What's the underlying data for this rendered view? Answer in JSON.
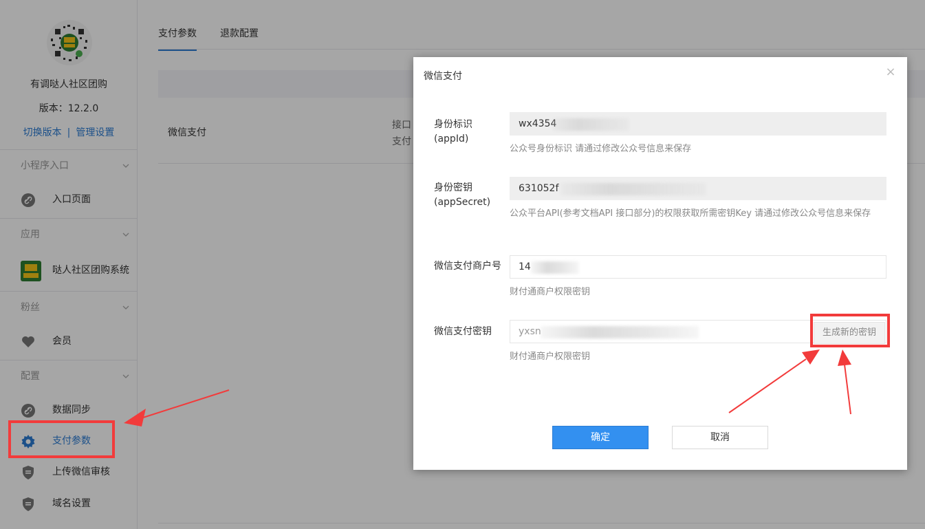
{
  "sidebar": {
    "app_name": "有调哒人社区团购",
    "version": "版本：12.2.0",
    "switch_version": "切换版本",
    "separator": "|",
    "manage_settings": "管理设置",
    "sections": [
      {
        "title": "小程序入口",
        "items": [
          {
            "label": "入口页面",
            "icon": "link-icon"
          }
        ]
      },
      {
        "title": "应用",
        "items": [
          {
            "label": "哒人社区团购系统",
            "icon": "app-logo-icon"
          }
        ]
      },
      {
        "title": "粉丝",
        "items": [
          {
            "label": "会员",
            "icon": "heart-icon"
          }
        ]
      },
      {
        "title": "配置",
        "items": [
          {
            "label": "数据同步",
            "icon": "link-icon"
          },
          {
            "label": "支付参数",
            "icon": "gear-icon"
          },
          {
            "label": "上传微信审核",
            "icon": "shield-icon"
          },
          {
            "label": "域名设置",
            "icon": "shield-icon"
          }
        ]
      }
    ]
  },
  "main": {
    "tabs": [
      {
        "label": "支付参数",
        "active": true
      },
      {
        "label": "退款配置",
        "active": false
      }
    ],
    "row": {
      "name": "微信支付",
      "info_line1": "接口",
      "info_line2": "支付"
    }
  },
  "modal": {
    "title": "微信支付",
    "close": "×",
    "fields": [
      {
        "label_line1": "身份标识",
        "label_line2": "(appId)",
        "value": "wx4354",
        "help": "公众号身份标识 请通过修改公众号信息来保存"
      },
      {
        "label_line1": "身份密钥",
        "label_line2": "(appSecret)",
        "value": "631052f",
        "help": "公众平台API(参考文档API 接口部分)的权限获取所需密钥Key 请通过修改公众号信息来保存"
      },
      {
        "label_line1": "微信支付商户号",
        "label_line2": "",
        "value": "14",
        "help": "财付通商户权限密钥"
      },
      {
        "label_line1": "微信支付密钥",
        "label_line2": "",
        "value": "yxsn",
        "help": "财付通商户权限密钥"
      }
    ],
    "generate_key": "生成新的密钥",
    "confirm": "确定",
    "cancel": "取消"
  },
  "colors": {
    "accent": "#2b7cd3",
    "primary_button": "#3390f0",
    "annotation_red": "#f23b3b"
  }
}
